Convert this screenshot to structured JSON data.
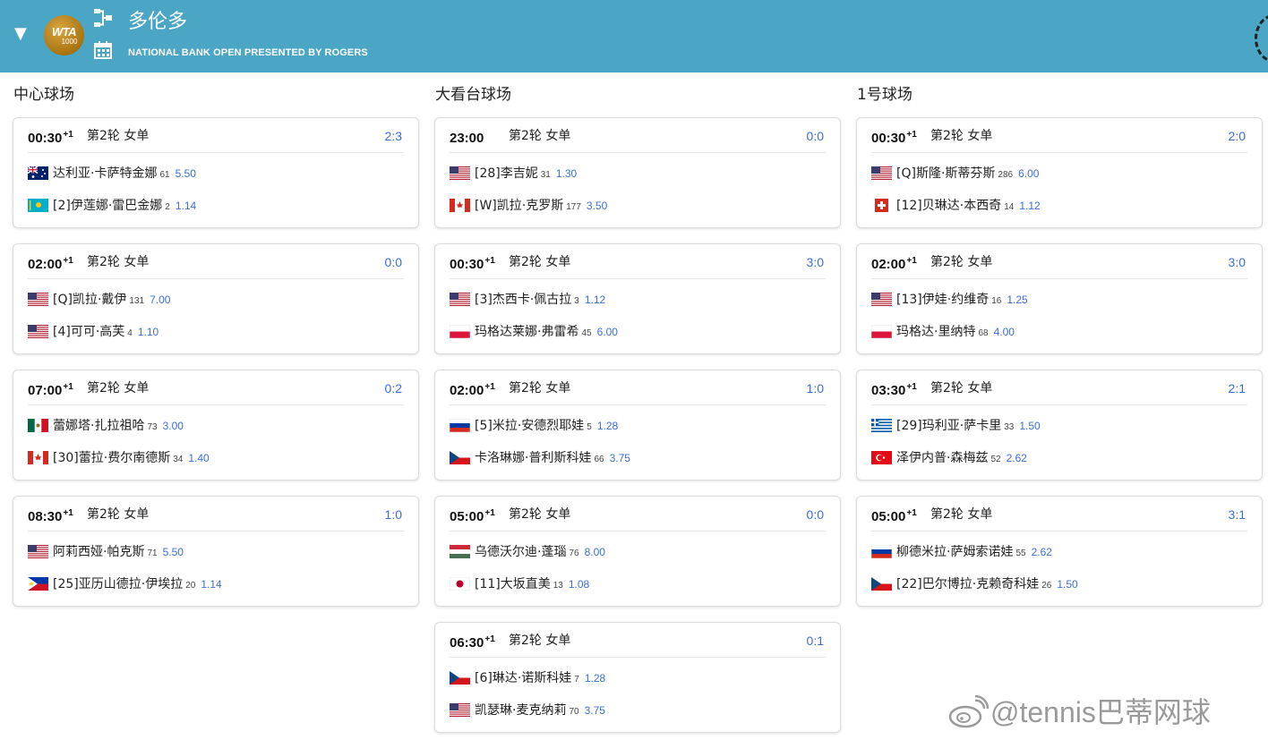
{
  "header": {
    "collapse_glyph": "▼",
    "logo_line1": "WTA",
    "logo_line2": "1000",
    "title": "多伦多",
    "subtitle": "NATIONAL BANK OPEN PRESENTED BY ROGERS"
  },
  "columns": [
    {
      "title": "中心球场",
      "matches": [
        {
          "time": "00:30",
          "day_offset": "+1",
          "round": "第2轮 女单",
          "h2h": "2:3",
          "p1": {
            "flag": "AU",
            "name": "达利亚·卡萨特金娜",
            "rank": "61",
            "odds": "5.50"
          },
          "p2": {
            "flag": "KZ",
            "name": "[2]伊莲娜·雷巴金娜",
            "rank": "2",
            "odds": "1.14"
          }
        },
        {
          "time": "02:00",
          "day_offset": "+1",
          "round": "第2轮 女单",
          "h2h": "0:0",
          "p1": {
            "flag": "US",
            "name": "[Q]凯拉·戴伊",
            "rank": "131",
            "odds": "7.00"
          },
          "p2": {
            "flag": "US",
            "name": "[4]可可·高芙",
            "rank": "4",
            "odds": "1.10"
          }
        },
        {
          "time": "07:00",
          "day_offset": "+1",
          "round": "第2轮 女单",
          "h2h": "0:2",
          "p1": {
            "flag": "MX",
            "name": "蕾娜塔·扎拉祖哈",
            "rank": "73",
            "odds": "3.00"
          },
          "p2": {
            "flag": "CA",
            "name": "[30]蕾拉·费尔南德斯",
            "rank": "34",
            "odds": "1.40"
          }
        },
        {
          "time": "08:30",
          "day_offset": "+1",
          "round": "第2轮 女单",
          "h2h": "1:0",
          "p1": {
            "flag": "US",
            "name": "阿莉西娅·帕克斯",
            "rank": "71",
            "odds": "5.50"
          },
          "p2": {
            "flag": "PH",
            "name": "[25]亚历山德拉·伊埃拉",
            "rank": "20",
            "odds": "1.14"
          }
        }
      ]
    },
    {
      "title": "大看台球场",
      "matches": [
        {
          "time": "23:00",
          "day_offset": "",
          "round": "第2轮 女单",
          "h2h": "0:0",
          "p1": {
            "flag": "US",
            "name": "[28]李吉妮",
            "rank": "31",
            "odds": "1.30"
          },
          "p2": {
            "flag": "CA",
            "name": "[W]凯拉·克罗斯",
            "rank": "177",
            "odds": "3.50"
          }
        },
        {
          "time": "00:30",
          "day_offset": "+1",
          "round": "第2轮 女单",
          "h2h": "3:0",
          "p1": {
            "flag": "US",
            "name": "[3]杰西卡·佩古拉",
            "rank": "3",
            "odds": "1.12"
          },
          "p2": {
            "flag": "PL",
            "name": "玛格达莱娜·弗雷希",
            "rank": "45",
            "odds": "6.00"
          }
        },
        {
          "time": "02:00",
          "day_offset": "+1",
          "round": "第2轮 女单",
          "h2h": "1:0",
          "p1": {
            "flag": "RU",
            "name": "[5]米拉·安德烈耶娃",
            "rank": "5",
            "odds": "1.28"
          },
          "p2": {
            "flag": "CZ",
            "name": "卡洛琳娜·普利斯科娃",
            "rank": "66",
            "odds": "3.75"
          }
        },
        {
          "time": "05:00",
          "day_offset": "+1",
          "round": "第2轮 女单",
          "h2h": "0:0",
          "p1": {
            "flag": "HU",
            "name": "乌德沃尔迪·蓬瑙",
            "rank": "76",
            "odds": "8.00"
          },
          "p2": {
            "flag": "JP",
            "name": "[11]大坂直美",
            "rank": "13",
            "odds": "1.08"
          }
        },
        {
          "time": "06:30",
          "day_offset": "+1",
          "round": "第2轮 女单",
          "h2h": "0:1",
          "p1": {
            "flag": "CZ",
            "name": "[6]琳达·诺斯科娃",
            "rank": "7",
            "odds": "1.28"
          },
          "p2": {
            "flag": "US",
            "name": "凯瑟琳·麦克纳莉",
            "rank": "70",
            "odds": "3.75"
          }
        }
      ]
    },
    {
      "title": "1号球场",
      "matches": [
        {
          "time": "00:30",
          "day_offset": "+1",
          "round": "第2轮 女单",
          "h2h": "2:0",
          "p1": {
            "flag": "US",
            "name": "[Q]斯隆·斯蒂芬斯",
            "rank": "286",
            "odds": "6.00"
          },
          "p2": {
            "flag": "CH",
            "name": "[12]贝琳达·本西奇",
            "rank": "14",
            "odds": "1.12"
          }
        },
        {
          "time": "02:00",
          "day_offset": "+1",
          "round": "第2轮 女单",
          "h2h": "3:0",
          "p1": {
            "flag": "US",
            "name": "[13]伊娃·约维奇",
            "rank": "16",
            "odds": "1.25"
          },
          "p2": {
            "flag": "PL",
            "name": "玛格达·里纳特",
            "rank": "68",
            "odds": "4.00"
          }
        },
        {
          "time": "03:30",
          "day_offset": "+1",
          "round": "第2轮 女单",
          "h2h": "2:1",
          "p1": {
            "flag": "GR",
            "name": "[29]玛利亚·萨卡里",
            "rank": "33",
            "odds": "1.50"
          },
          "p2": {
            "flag": "TR",
            "name": "泽伊内普·森梅兹",
            "rank": "52",
            "odds": "2.62"
          }
        },
        {
          "time": "05:00",
          "day_offset": "+1",
          "round": "第2轮 女单",
          "h2h": "3:1",
          "p1": {
            "flag": "RU",
            "name": "柳德米拉·萨姆索诺娃",
            "rank": "55",
            "odds": "2.62"
          },
          "p2": {
            "flag": "CZ",
            "name": "[22]巴尔博拉·克赖奇科娃",
            "rank": "26",
            "odds": "1.50"
          }
        }
      ]
    }
  ],
  "watermark": "@tennis巴蒂网球",
  "colors": {
    "header_bg": "#4aa6c4",
    "link_blue": "#3a6fd8",
    "logo_gold": "#b5831b"
  }
}
